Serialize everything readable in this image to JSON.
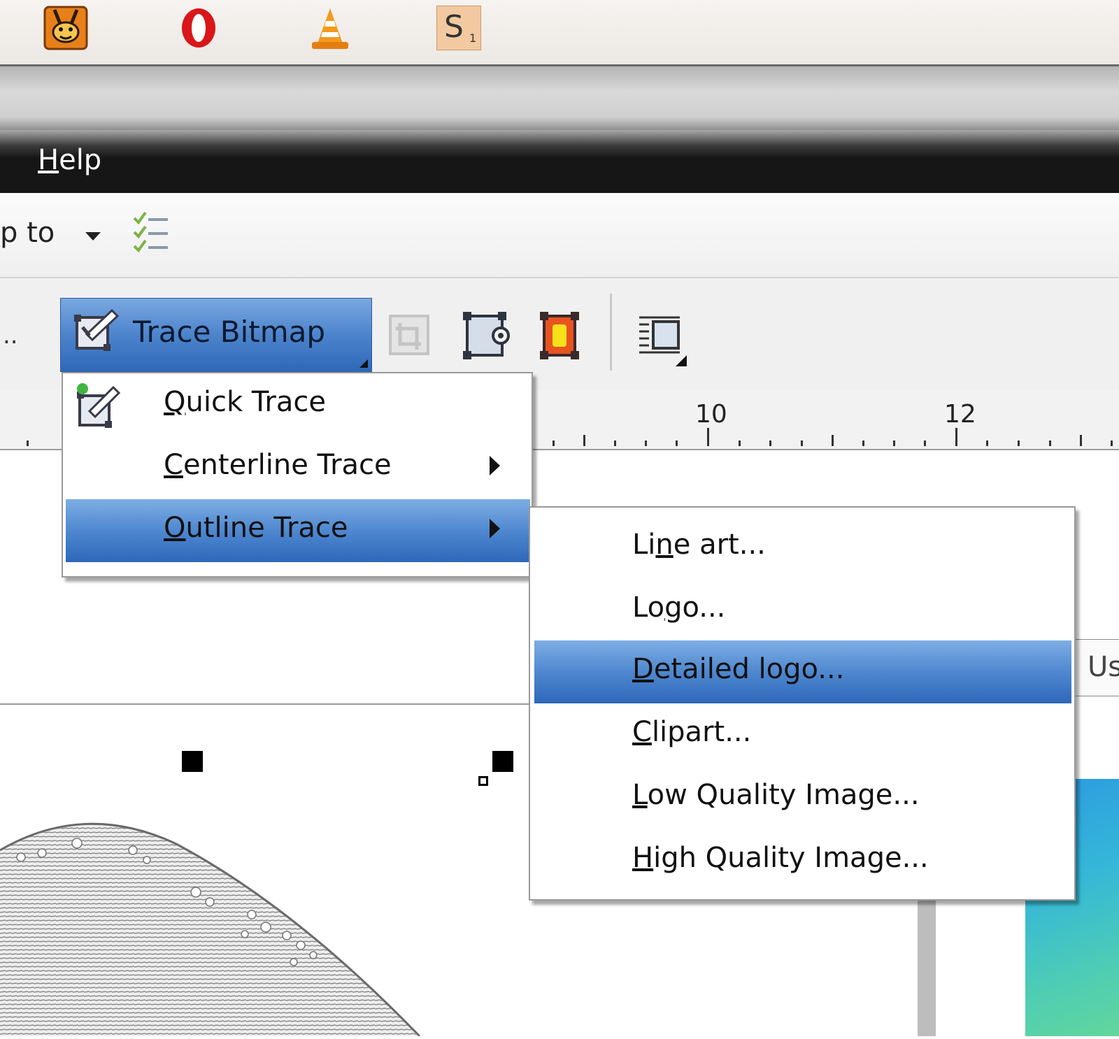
{
  "taskbar": {
    "icons": [
      "rabbit-app-icon",
      "opera-icon",
      "vlc-icon",
      "scrabble-tile-icon"
    ],
    "scrabble_letter": "S",
    "scrabble_sub": "1"
  },
  "menubar": {
    "help_mnemonic": "H",
    "help_rest": "elp"
  },
  "propbar": {
    "snap_label": "p to"
  },
  "toolbar": {
    "ellipsis": "..",
    "trace_bitmap_label": "Trace Bitmap"
  },
  "ruler": {
    "label_10": "10",
    "label_12": "12"
  },
  "trace_menu": {
    "quick": {
      "u": "Q",
      "rest": "uick Trace"
    },
    "centerline": {
      "u": "C",
      "rest": "enterline Trace"
    },
    "outline": {
      "u": "O",
      "rest": "utline Trace"
    }
  },
  "outline_submenu": {
    "line_art": {
      "pre": "Li",
      "u": "n",
      "rest": "e art..."
    },
    "logo": {
      "pre": "Lo",
      "u": "g",
      "rest": "o..."
    },
    "detailed_logo": {
      "pre": "",
      "u": "D",
      "rest": "etailed logo..."
    },
    "clipart": {
      "pre": "",
      "u": "C",
      "rest": "lipart..."
    },
    "low_quality": {
      "pre": "",
      "u": "L",
      "rest": "ow Quality Image..."
    },
    "high_quality": {
      "pre": "",
      "u": "H",
      "rest": "igh Quality Image..."
    }
  },
  "tooltip": {
    "text": "Us"
  },
  "colors": {
    "highlight": "#4f88d0",
    "menubar": "#161616",
    "accent_blue": "#2e67b8"
  }
}
